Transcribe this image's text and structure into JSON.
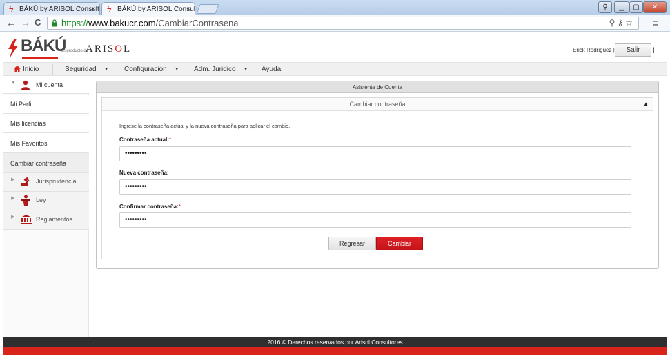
{
  "browser": {
    "tabs": [
      {
        "title": "BÁKÚ by ARISOL Consulto",
        "active": false
      },
      {
        "title": "BÁKÚ by ARISOL Consulto",
        "active": true
      }
    ],
    "close_glyph": "×",
    "url": {
      "scheme": "https://",
      "host": "www.bakucr.com",
      "path": "/CambiarContrasena"
    },
    "window_buttons": {
      "user": "⚲",
      "minimize": "▁",
      "maximize": "▢",
      "close": "✕"
    },
    "nav_icons": {
      "back": "←",
      "forward": "→",
      "reload": "C"
    },
    "omni_icons": "⚲⚷☆",
    "menu_icon": "≡"
  },
  "header": {
    "logo_text": "BÁKÚ",
    "logo_sub": "un producto de",
    "logo_brand_pre": "ARIS",
    "logo_brand_o": "O",
    "logo_brand_post": "L",
    "user_name": "Erick Rodriguez | [",
    "logout_label": "Salir",
    "logout_bracket": "]"
  },
  "nav": {
    "items": [
      {
        "label": "Inicio"
      },
      {
        "label": "Seguridad"
      },
      {
        "label": "Configuración"
      },
      {
        "label": "Adm. Juridico"
      },
      {
        "label": "Ayuda"
      }
    ],
    "caret": "▼"
  },
  "sidebar": {
    "group": "Mi cuenta",
    "items": [
      "Mi Perfil",
      "Mis licencias",
      "Mis Favoritos",
      "Cambiar contraseña"
    ],
    "sections": [
      "Jurisprudencia",
      "Ley",
      "Reglamentos"
    ],
    "open_tri": "▼",
    "closed_tri": "▶"
  },
  "main": {
    "panel_title": "Asistente de Cuenta",
    "section_title": "Cambiar contraseña",
    "collapse_glyph": "▲",
    "intro": "Ingrese la contraseña actual y la nueva contraseña para aplicar el cambio.",
    "fields": [
      {
        "label": "Contraseña actual:",
        "required": true,
        "value": "•••••••••"
      },
      {
        "label": "Nueva contraseña:",
        "required": false,
        "value": "•••••••••"
      },
      {
        "label": "Confirmar contraseña:",
        "required": true,
        "value": "•••••••••"
      }
    ],
    "required_mark": "*",
    "back_label": "Regresar",
    "submit_label": "Cambiar"
  },
  "footer": {
    "text": "2016 © Derechos reservados por Arisol Consultores"
  },
  "colors": {
    "brand_red": "#d9241c",
    "footer_dark": "#2f2f2f",
    "nav_bg": "#f0f0f0"
  }
}
